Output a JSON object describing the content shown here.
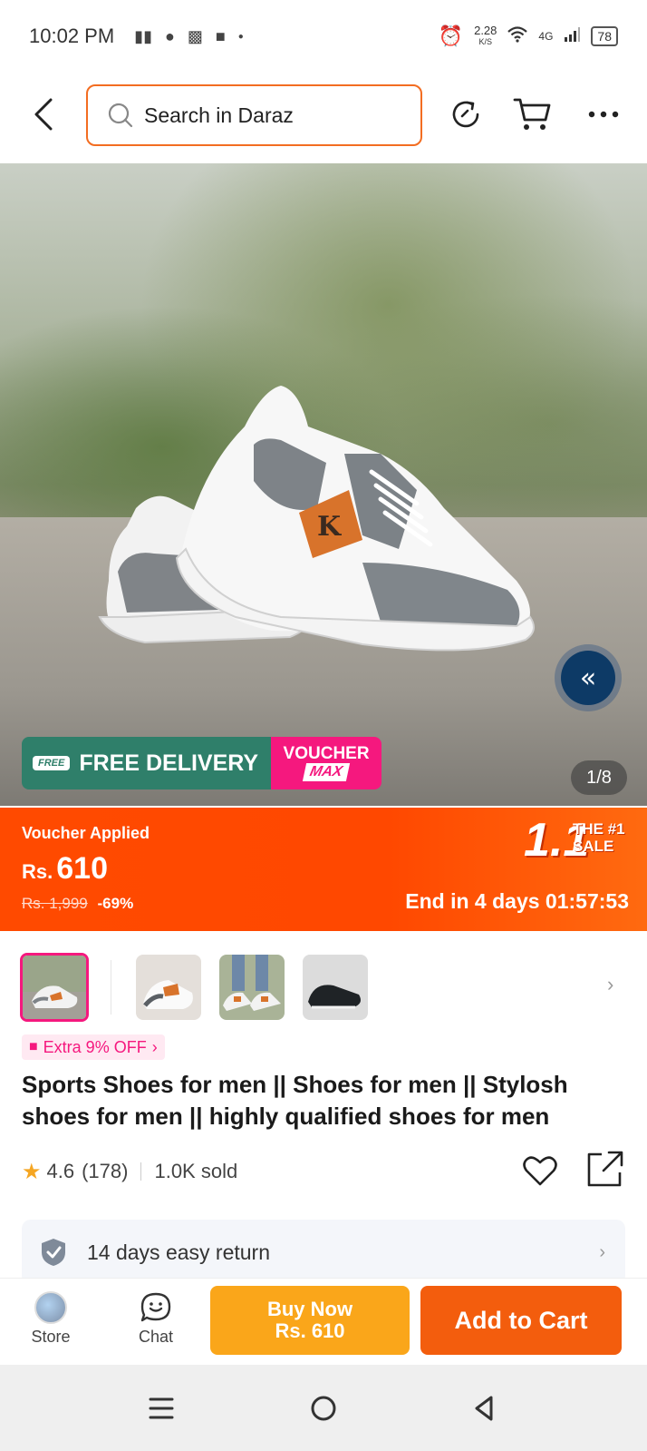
{
  "status_bar": {
    "time": "10:02 PM",
    "net_speed_value": "2.28",
    "net_speed_unit": "K/S",
    "network": "4G",
    "battery": "78"
  },
  "header": {
    "search_placeholder": "Search in Daraz",
    "accent_color": "#f36d21"
  },
  "hero": {
    "image_counter": "1/8",
    "promo_free_delivery": "FREE DELIVERY",
    "promo_free_tag": "FREE",
    "promo_voucher_line1": "VOUCHER",
    "promo_voucher_line2": "MAX"
  },
  "price_banner": {
    "voucher_applied": "Voucher Applied",
    "currency": "Rs.",
    "price": "610",
    "old_price": "Rs. 1,999",
    "discount": "-69%",
    "sale_big": "1.1",
    "sale_small_line1": "THE #1",
    "sale_small_line2": "SALE",
    "sale_end": "End in 4 days 01:57:53",
    "color": "#ff4a00"
  },
  "coupon": {
    "label": "Extra 9% OFF"
  },
  "product": {
    "title": "Sports Shoes for men || Shoes for men || Stylosh shoes for men || highly qualified shoes for men",
    "rating": "4.6",
    "reviews": "(178)",
    "sold": "1.0K sold"
  },
  "return_policy": {
    "label": "14 days easy return"
  },
  "action_bar": {
    "store_label": "Store",
    "chat_label": "Chat",
    "buy_now_label": "Buy Now",
    "buy_now_price": "Rs. 610",
    "add_to_cart_label": "Add to Cart",
    "buy_now_color": "#faa61a",
    "add_to_cart_color": "#f35d0d"
  }
}
